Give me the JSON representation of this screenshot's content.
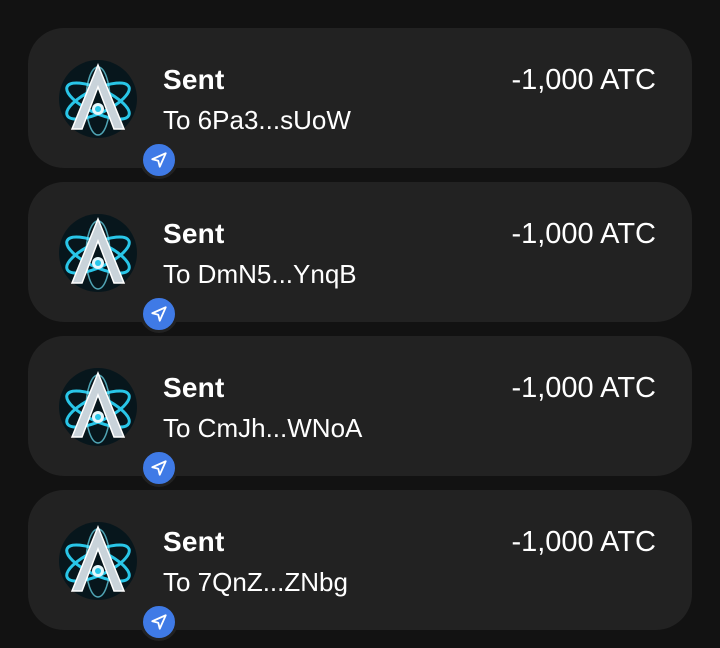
{
  "transactions": [
    {
      "title": "Sent",
      "recipient": "To 6Pa3...sUoW",
      "amount": "-1,000 ATC",
      "token_icon": "atom-a-token-icon",
      "badge_icon": "send-arrow-icon"
    },
    {
      "title": "Sent",
      "recipient": "To DmN5...YnqB",
      "amount": "-1,000 ATC",
      "token_icon": "atom-a-token-icon",
      "badge_icon": "send-arrow-icon"
    },
    {
      "title": "Sent",
      "recipient": "To CmJh...WNoA",
      "amount": "-1,000 ATC",
      "token_icon": "atom-a-token-icon",
      "badge_icon": "send-arrow-icon"
    },
    {
      "title": "Sent",
      "recipient": "To 7QnZ...ZNbg",
      "amount": "-1,000 ATC",
      "token_icon": "atom-a-token-icon",
      "badge_icon": "send-arrow-icon"
    }
  ],
  "colors": {
    "background": "#121212",
    "card": "#222222",
    "badge": "#3f7ae6",
    "text": "#ffffff",
    "logo_glow": "#29c6e8"
  }
}
